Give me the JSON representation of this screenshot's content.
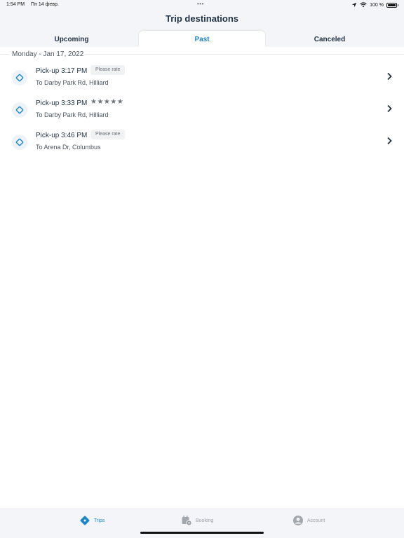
{
  "status_bar": {
    "time": "1:54 PM",
    "date": "Пн 14 февр.",
    "multitask_dots": "•••",
    "battery": "100 %"
  },
  "header": {
    "title": "Trip destinations"
  },
  "tabs": [
    {
      "label": "Upcoming",
      "selected": false
    },
    {
      "label": "Past",
      "selected": true
    },
    {
      "label": "Canceled",
      "selected": false
    }
  ],
  "section": {
    "date": "Monday - Jan 17, 2022",
    "trips": [
      {
        "time": "Pick-up 3:17 PM",
        "badge": "Please rate",
        "destination": "To Darby Park Rd, Hilliard"
      },
      {
        "time": "Pick-up 3:33 PM",
        "rating_stars": "★★★★★",
        "rating": 5,
        "destination": "To Darby Park Rd, Hilliard"
      },
      {
        "time": "Pick-up 3:46 PM",
        "badge": "Please rate",
        "destination": "To Arena Dr, Columbus"
      }
    ]
  },
  "tab_bar": {
    "items": [
      {
        "label": "Trips",
        "icon": "ticket-icon",
        "active": true
      },
      {
        "label": "Booking",
        "icon": "calendar-plus-icon",
        "active": false
      },
      {
        "label": "Account",
        "icon": "person-circle-icon",
        "active": false
      }
    ]
  },
  "colors": {
    "accent": "#1c86c7",
    "text_dark": "#1f3144",
    "header_bg": "#f4f5f8"
  }
}
